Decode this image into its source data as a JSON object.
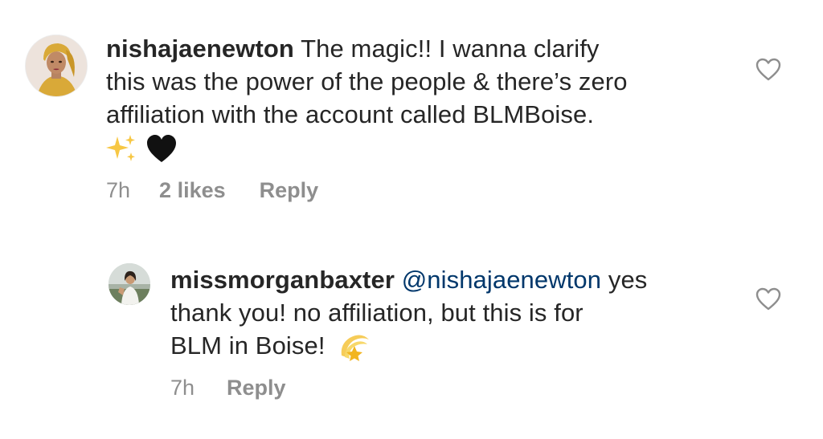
{
  "comments": [
    {
      "username": "nishajaenewton",
      "text_lines": [
        "The magic!! I wanna clarify",
        "this was the power of the people & there’s zero",
        "affiliation with the account called BLMBoise."
      ],
      "emojis": [
        "sparkles-emoji",
        "black-heart-emoji"
      ],
      "time": "7h",
      "likes": "2 likes",
      "reply_label": "Reply",
      "like_icon": "heart-outline-icon"
    },
    {
      "username": "missmorganbaxter",
      "mention": "@nishajaenewton",
      "text_after_mention": "yes",
      "text_lines": [
        "thank you! no affiliation, but this is for",
        "BLM in Boise!"
      ],
      "emojis": [
        "dizzy-emoji"
      ],
      "time": "7h",
      "reply_label": "Reply",
      "like_icon": "heart-outline-icon"
    }
  ],
  "colors": {
    "text": "#262626",
    "secondary": "#8e8e8e",
    "mention": "#00376b",
    "background": "#ffffff"
  }
}
